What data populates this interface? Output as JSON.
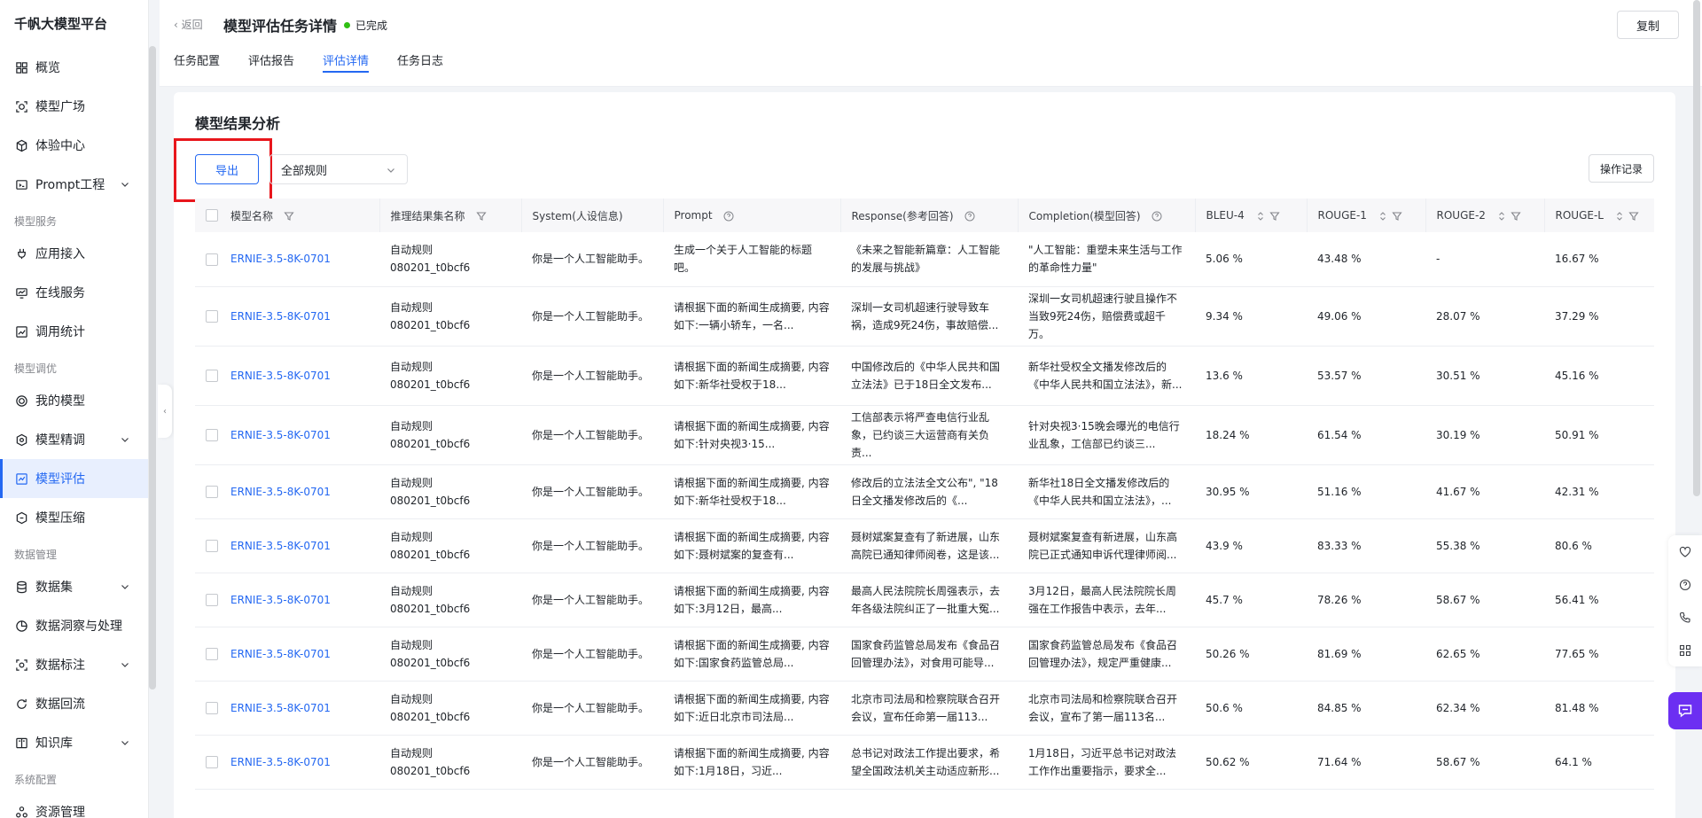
{
  "app": {
    "brand": "千帆大模型平台"
  },
  "sidebar": {
    "items": [
      {
        "label": "概览",
        "icon": "grid-icon"
      },
      {
        "label": "模型广场",
        "icon": "model-square-icon"
      },
      {
        "label": "体验中心",
        "icon": "cube-icon"
      },
      {
        "label": "Prompt工程",
        "icon": "prompt-icon"
      }
    ],
    "groups": {
      "service": "模型服务",
      "tuning": "模型调优",
      "data": "数据管理",
      "system": "系统配置"
    },
    "service_items": [
      {
        "label": "应用接入"
      },
      {
        "label": "在线服务"
      },
      {
        "label": "调用统计"
      }
    ],
    "tuning_items": [
      {
        "label": "我的模型"
      },
      {
        "label": "模型精调"
      },
      {
        "label": "模型评估"
      },
      {
        "label": "模型压缩"
      }
    ],
    "data_items": [
      {
        "label": "数据集"
      },
      {
        "label": "数据洞察与处理"
      },
      {
        "label": "数据标注"
      },
      {
        "label": "数据回流"
      },
      {
        "label": "知识库"
      }
    ],
    "system_items": [
      {
        "label": "资源管理"
      }
    ]
  },
  "header": {
    "back": "返回",
    "title": "模型评估任务详情",
    "status": "已完成",
    "copy": "复制",
    "tabs": [
      "任务配置",
      "评估报告",
      "评估详情",
      "任务日志"
    ]
  },
  "card": {
    "title": "模型结果分析",
    "export": "导出",
    "rule_select": "全部规则",
    "oplog": "操作记录"
  },
  "table": {
    "headers": [
      "模型名称",
      "推理结果集名称",
      "System(人设信息)",
      "Prompt",
      "Response(参考回答)",
      "Completion(模型回答)",
      "BLEU-4",
      "ROUGE-1",
      "ROUGE-2",
      "ROUGE-L"
    ],
    "rows": [
      {
        "model": "ERNIE-3.5-8K-0701",
        "dataset": "自动规则 080201_t0bcf6",
        "system": "你是一个人工智能助手。",
        "prompt": "生成一个关于人工智能的标题吧。",
        "response": "《未来之智能新篇章：人工智能的发展与挑战》",
        "completion": "\"人工智能：重塑未来生活与工作的革命性力量\"",
        "bleu4": "5.06 %",
        "rouge1": "43.48 %",
        "rouge2": "-",
        "rougel": "16.67 %"
      },
      {
        "model": "ERNIE-3.5-8K-0701",
        "dataset": "自动规则 080201_t0bcf6",
        "system": "你是一个人工智能助手。",
        "prompt": "请根据下面的新闻生成摘要, 内容如下:一辆小轿车，一名...",
        "response": "深圳一女司机超速行驶导致车祸，造成9死24伤，事故赔偿...",
        "completion": "深圳一女司机超速行驶且操作不当致9死24伤，赔偿费或超千万。",
        "bleu4": "9.34 %",
        "rouge1": "49.06 %",
        "rouge2": "28.07 %",
        "rougel": "37.29 %"
      },
      {
        "model": "ERNIE-3.5-8K-0701",
        "dataset": "自动规则 080201_t0bcf6",
        "system": "你是一个人工智能助手。",
        "prompt": "请根据下面的新闻生成摘要, 内容如下:新华社受权于18...",
        "response": "中国修改后的《中华人民共和国立法法》已于18日全文发布...",
        "completion": "新华社受权全文播发修改后的《中华人民共和国立法法》，新...",
        "bleu4": "13.6 %",
        "rouge1": "53.57 %",
        "rouge2": "30.51 %",
        "rougel": "45.16 %"
      },
      {
        "model": "ERNIE-3.5-8K-0701",
        "dataset": "自动规则 080201_t0bcf6",
        "system": "你是一个人工智能助手。",
        "prompt": "请根据下面的新闻生成摘要, 内容如下:针对央视3·15...",
        "response": "工信部表示将严查电信行业乱象，已约谈三大运营商有关负责...",
        "completion": "针对央视3·15晚会曝光的电信行业乱象，工信部已约谈三...",
        "bleu4": "18.24 %",
        "rouge1": "61.54 %",
        "rouge2": "30.19 %",
        "rougel": "50.91 %"
      },
      {
        "model": "ERNIE-3.5-8K-0701",
        "dataset": "自动规则 080201_t0bcf6",
        "system": "你是一个人工智能助手。",
        "prompt": "请根据下面的新闻生成摘要, 内容如下:新华社受权于18...",
        "response": "修改后的立法法全文公布\", \"18日全文播发修改后的《...",
        "completion": "新华社18日全文播发修改后的《中华人民共和国立法法》，...",
        "bleu4": "30.95 %",
        "rouge1": "51.16 %",
        "rouge2": "41.67 %",
        "rougel": "42.31 %"
      },
      {
        "model": "ERNIE-3.5-8K-0701",
        "dataset": "自动规则 080201_t0bcf6",
        "system": "你是一个人工智能助手。",
        "prompt": "请根据下面的新闻生成摘要, 内容如下:聂树斌案的复查有...",
        "response": "聂树斌案复查有了新进展，山东高院已通知律师阅卷，这是该...",
        "completion": "聂树斌案复查有新进展，山东高院已正式通知申诉代理律师阅...",
        "bleu4": "43.9 %",
        "rouge1": "83.33 %",
        "rouge2": "55.38 %",
        "rougel": "80.6 %"
      },
      {
        "model": "ERNIE-3.5-8K-0701",
        "dataset": "自动规则 080201_t0bcf6",
        "system": "你是一个人工智能助手。",
        "prompt": "请根据下面的新闻生成摘要, 内容如下:3月12日，最高...",
        "response": "最高人民法院院长周强表示，去年各级法院纠正了一批重大冤...",
        "completion": "3月12日，最高人民法院院长周强在工作报告中表示，去年...",
        "bleu4": "45.7 %",
        "rouge1": "78.26 %",
        "rouge2": "58.67 %",
        "rougel": "56.41 %"
      },
      {
        "model": "ERNIE-3.5-8K-0701",
        "dataset": "自动规则 080201_t0bcf6",
        "system": "你是一个人工智能助手。",
        "prompt": "请根据下面的新闻生成摘要, 内容如下:国家食药监管总局...",
        "response": "国家食药监管总局发布《食品召回管理办法》，对食用可能导...",
        "completion": "国家食药监管总局发布《食品召回管理办法》，规定严重健康...",
        "bleu4": "50.26 %",
        "rouge1": "81.69 %",
        "rouge2": "62.65 %",
        "rougel": "77.65 %"
      },
      {
        "model": "ERNIE-3.5-8K-0701",
        "dataset": "自动规则 080201_t0bcf6",
        "system": "你是一个人工智能助手。",
        "prompt": "请根据下面的新闻生成摘要, 内容如下:近日北京市司法局...",
        "response": "北京市司法局和检察院联合召开会议，宣布任命第一届113...",
        "completion": "北京市司法局和检察院联合召开会议，宣布了第一届113名...",
        "bleu4": "50.6 %",
        "rouge1": "84.85 %",
        "rouge2": "62.34 %",
        "rougel": "81.48 %"
      },
      {
        "model": "ERNIE-3.5-8K-0701",
        "dataset": "自动规则 080201_t0bcf6",
        "system": "你是一个人工智能助手。",
        "prompt": "请根据下面的新闻生成摘要, 内容如下:1月18日，习近...",
        "response": "总书记对政法工作提出要求，希望全国政法机关主动适应新形...",
        "completion": "1月18日，习近平总书记对政法工作作出重要指示，要求全...",
        "bleu4": "50.62 %",
        "rouge1": "71.64 %",
        "rouge2": "58.67 %",
        "rougel": "64.1 %"
      }
    ]
  },
  "colors": {
    "primary": "#2468f2",
    "highlight": "#e8161c",
    "success": "#30bf13",
    "chat": "#6c2ff2"
  }
}
